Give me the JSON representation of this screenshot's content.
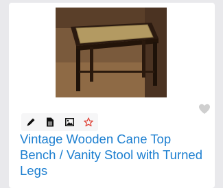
{
  "listing": {
    "photo_icon": "bench-photo",
    "title": "Vintage Wooden Cane Top Bench / Vanity Stool with Turned Legs",
    "favorite_icon": "heart-icon"
  },
  "toolbar": {
    "icons": [
      "pencil-icon",
      "document-icon",
      "image-icon",
      "star-icon"
    ]
  },
  "colors": {
    "title": "#1d7fd0",
    "star": "#e0453a",
    "heart": "#cfcfcf",
    "background": "#e9e9ec"
  }
}
